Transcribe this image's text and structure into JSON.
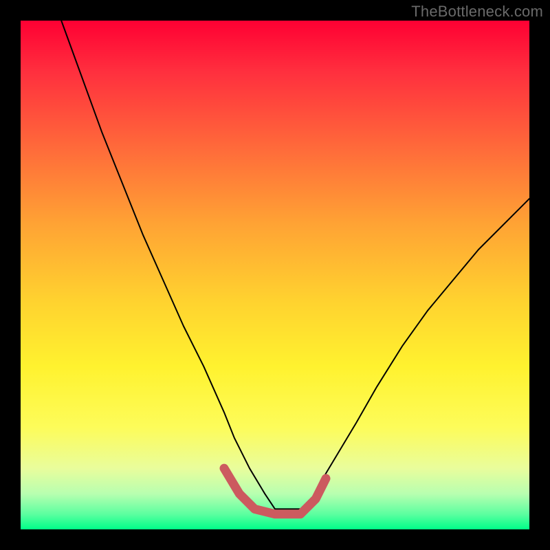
{
  "watermark": "TheBottleneck.com",
  "chart_data": {
    "type": "line",
    "title": "",
    "xlabel": "",
    "ylabel": "",
    "xlim": [
      0,
      100
    ],
    "ylim": [
      0,
      100
    ],
    "gradient": {
      "top": "red",
      "middle": "yellow",
      "bottom": "green"
    },
    "series": [
      {
        "name": "curve",
        "color": "#000000",
        "x": [
          8,
          12,
          16,
          20,
          24,
          28,
          32,
          36,
          40,
          42,
          45,
          48,
          50,
          55,
          58,
          60,
          63,
          66,
          70,
          75,
          80,
          85,
          90,
          95,
          100
        ],
        "y": [
          100,
          89,
          78,
          68,
          58,
          49,
          40,
          32,
          23,
          18,
          12,
          7,
          4,
          4,
          7,
          11,
          16,
          21,
          28,
          36,
          43,
          49,
          55,
          60,
          65
        ]
      },
      {
        "name": "rounded-bottom-highlight",
        "color": "#cc5a5f",
        "x": [
          40,
          43,
          46,
          50,
          55,
          58,
          60
        ],
        "y": [
          12,
          7,
          4,
          3,
          3,
          6,
          10
        ]
      }
    ]
  }
}
